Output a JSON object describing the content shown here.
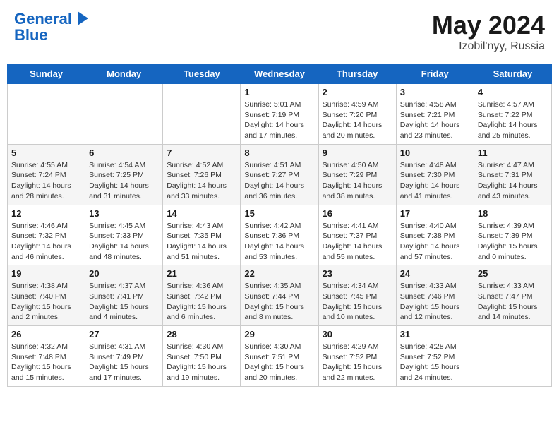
{
  "header": {
    "logo_line1": "General",
    "logo_line2": "Blue",
    "month_year": "May 2024",
    "location": "Izobil'nyy, Russia"
  },
  "weekdays": [
    "Sunday",
    "Monday",
    "Tuesday",
    "Wednesday",
    "Thursday",
    "Friday",
    "Saturday"
  ],
  "weeks": [
    [
      {
        "day": "",
        "info": ""
      },
      {
        "day": "",
        "info": ""
      },
      {
        "day": "",
        "info": ""
      },
      {
        "day": "1",
        "info": "Sunrise: 5:01 AM\nSunset: 7:19 PM\nDaylight: 14 hours\nand 17 minutes."
      },
      {
        "day": "2",
        "info": "Sunrise: 4:59 AM\nSunset: 7:20 PM\nDaylight: 14 hours\nand 20 minutes."
      },
      {
        "day": "3",
        "info": "Sunrise: 4:58 AM\nSunset: 7:21 PM\nDaylight: 14 hours\nand 23 minutes."
      },
      {
        "day": "4",
        "info": "Sunrise: 4:57 AM\nSunset: 7:22 PM\nDaylight: 14 hours\nand 25 minutes."
      }
    ],
    [
      {
        "day": "5",
        "info": "Sunrise: 4:55 AM\nSunset: 7:24 PM\nDaylight: 14 hours\nand 28 minutes."
      },
      {
        "day": "6",
        "info": "Sunrise: 4:54 AM\nSunset: 7:25 PM\nDaylight: 14 hours\nand 31 minutes."
      },
      {
        "day": "7",
        "info": "Sunrise: 4:52 AM\nSunset: 7:26 PM\nDaylight: 14 hours\nand 33 minutes."
      },
      {
        "day": "8",
        "info": "Sunrise: 4:51 AM\nSunset: 7:27 PM\nDaylight: 14 hours\nand 36 minutes."
      },
      {
        "day": "9",
        "info": "Sunrise: 4:50 AM\nSunset: 7:29 PM\nDaylight: 14 hours\nand 38 minutes."
      },
      {
        "day": "10",
        "info": "Sunrise: 4:48 AM\nSunset: 7:30 PM\nDaylight: 14 hours\nand 41 minutes."
      },
      {
        "day": "11",
        "info": "Sunrise: 4:47 AM\nSunset: 7:31 PM\nDaylight: 14 hours\nand 43 minutes."
      }
    ],
    [
      {
        "day": "12",
        "info": "Sunrise: 4:46 AM\nSunset: 7:32 PM\nDaylight: 14 hours\nand 46 minutes."
      },
      {
        "day": "13",
        "info": "Sunrise: 4:45 AM\nSunset: 7:33 PM\nDaylight: 14 hours\nand 48 minutes."
      },
      {
        "day": "14",
        "info": "Sunrise: 4:43 AM\nSunset: 7:35 PM\nDaylight: 14 hours\nand 51 minutes."
      },
      {
        "day": "15",
        "info": "Sunrise: 4:42 AM\nSunset: 7:36 PM\nDaylight: 14 hours\nand 53 minutes."
      },
      {
        "day": "16",
        "info": "Sunrise: 4:41 AM\nSunset: 7:37 PM\nDaylight: 14 hours\nand 55 minutes."
      },
      {
        "day": "17",
        "info": "Sunrise: 4:40 AM\nSunset: 7:38 PM\nDaylight: 14 hours\nand 57 minutes."
      },
      {
        "day": "18",
        "info": "Sunrise: 4:39 AM\nSunset: 7:39 PM\nDaylight: 15 hours\nand 0 minutes."
      }
    ],
    [
      {
        "day": "19",
        "info": "Sunrise: 4:38 AM\nSunset: 7:40 PM\nDaylight: 15 hours\nand 2 minutes."
      },
      {
        "day": "20",
        "info": "Sunrise: 4:37 AM\nSunset: 7:41 PM\nDaylight: 15 hours\nand 4 minutes."
      },
      {
        "day": "21",
        "info": "Sunrise: 4:36 AM\nSunset: 7:42 PM\nDaylight: 15 hours\nand 6 minutes."
      },
      {
        "day": "22",
        "info": "Sunrise: 4:35 AM\nSunset: 7:44 PM\nDaylight: 15 hours\nand 8 minutes."
      },
      {
        "day": "23",
        "info": "Sunrise: 4:34 AM\nSunset: 7:45 PM\nDaylight: 15 hours\nand 10 minutes."
      },
      {
        "day": "24",
        "info": "Sunrise: 4:33 AM\nSunset: 7:46 PM\nDaylight: 15 hours\nand 12 minutes."
      },
      {
        "day": "25",
        "info": "Sunrise: 4:33 AM\nSunset: 7:47 PM\nDaylight: 15 hours\nand 14 minutes."
      }
    ],
    [
      {
        "day": "26",
        "info": "Sunrise: 4:32 AM\nSunset: 7:48 PM\nDaylight: 15 hours\nand 15 minutes."
      },
      {
        "day": "27",
        "info": "Sunrise: 4:31 AM\nSunset: 7:49 PM\nDaylight: 15 hours\nand 17 minutes."
      },
      {
        "day": "28",
        "info": "Sunrise: 4:30 AM\nSunset: 7:50 PM\nDaylight: 15 hours\nand 19 minutes."
      },
      {
        "day": "29",
        "info": "Sunrise: 4:30 AM\nSunset: 7:51 PM\nDaylight: 15 hours\nand 20 minutes."
      },
      {
        "day": "30",
        "info": "Sunrise: 4:29 AM\nSunset: 7:52 PM\nDaylight: 15 hours\nand 22 minutes."
      },
      {
        "day": "31",
        "info": "Sunrise: 4:28 AM\nSunset: 7:52 PM\nDaylight: 15 hours\nand 24 minutes."
      },
      {
        "day": "",
        "info": ""
      }
    ]
  ]
}
